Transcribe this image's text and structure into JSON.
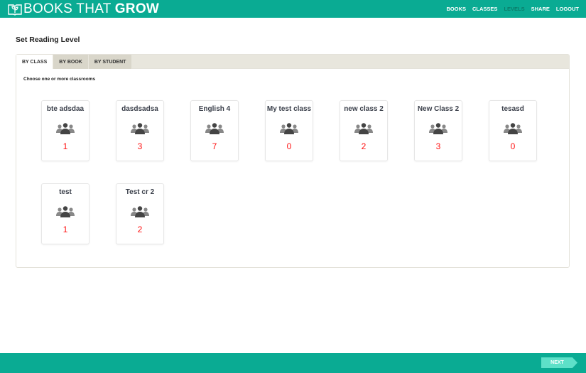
{
  "header": {
    "logo": {
      "light": "BOOKS THAT",
      "bold": "GROW"
    },
    "nav": [
      {
        "label": "BOOKS",
        "active": false
      },
      {
        "label": "CLASSES",
        "active": false
      },
      {
        "label": "LEVELS",
        "active": true
      },
      {
        "label": "SHARE",
        "active": false
      },
      {
        "label": "LOGOUT",
        "active": false
      }
    ]
  },
  "page": {
    "title": "Set Reading Level"
  },
  "tabs": [
    {
      "label": "BY CLASS",
      "active": true
    },
    {
      "label": "BY BOOK",
      "active": false
    },
    {
      "label": "BY STUDENT",
      "active": false
    }
  ],
  "hint": "Choose one or more classrooms",
  "classes": [
    {
      "name": "bte adsdaa",
      "count": "1"
    },
    {
      "name": "dasdsadsa",
      "count": "3"
    },
    {
      "name": "English 4",
      "count": "7"
    },
    {
      "name": "My test class",
      "count": "0"
    },
    {
      "name": "new class 2",
      "count": "2"
    },
    {
      "name": "New Class 2",
      "count": "3"
    },
    {
      "name": "tesasd",
      "count": "0"
    },
    {
      "name": "test",
      "count": "1"
    },
    {
      "name": "Test cr 2",
      "count": "2"
    }
  ],
  "footer": {
    "next_label": "NEXT"
  },
  "colors": {
    "brand": "#0aab93",
    "count": "#ff1111",
    "next": "#5de0c8"
  }
}
